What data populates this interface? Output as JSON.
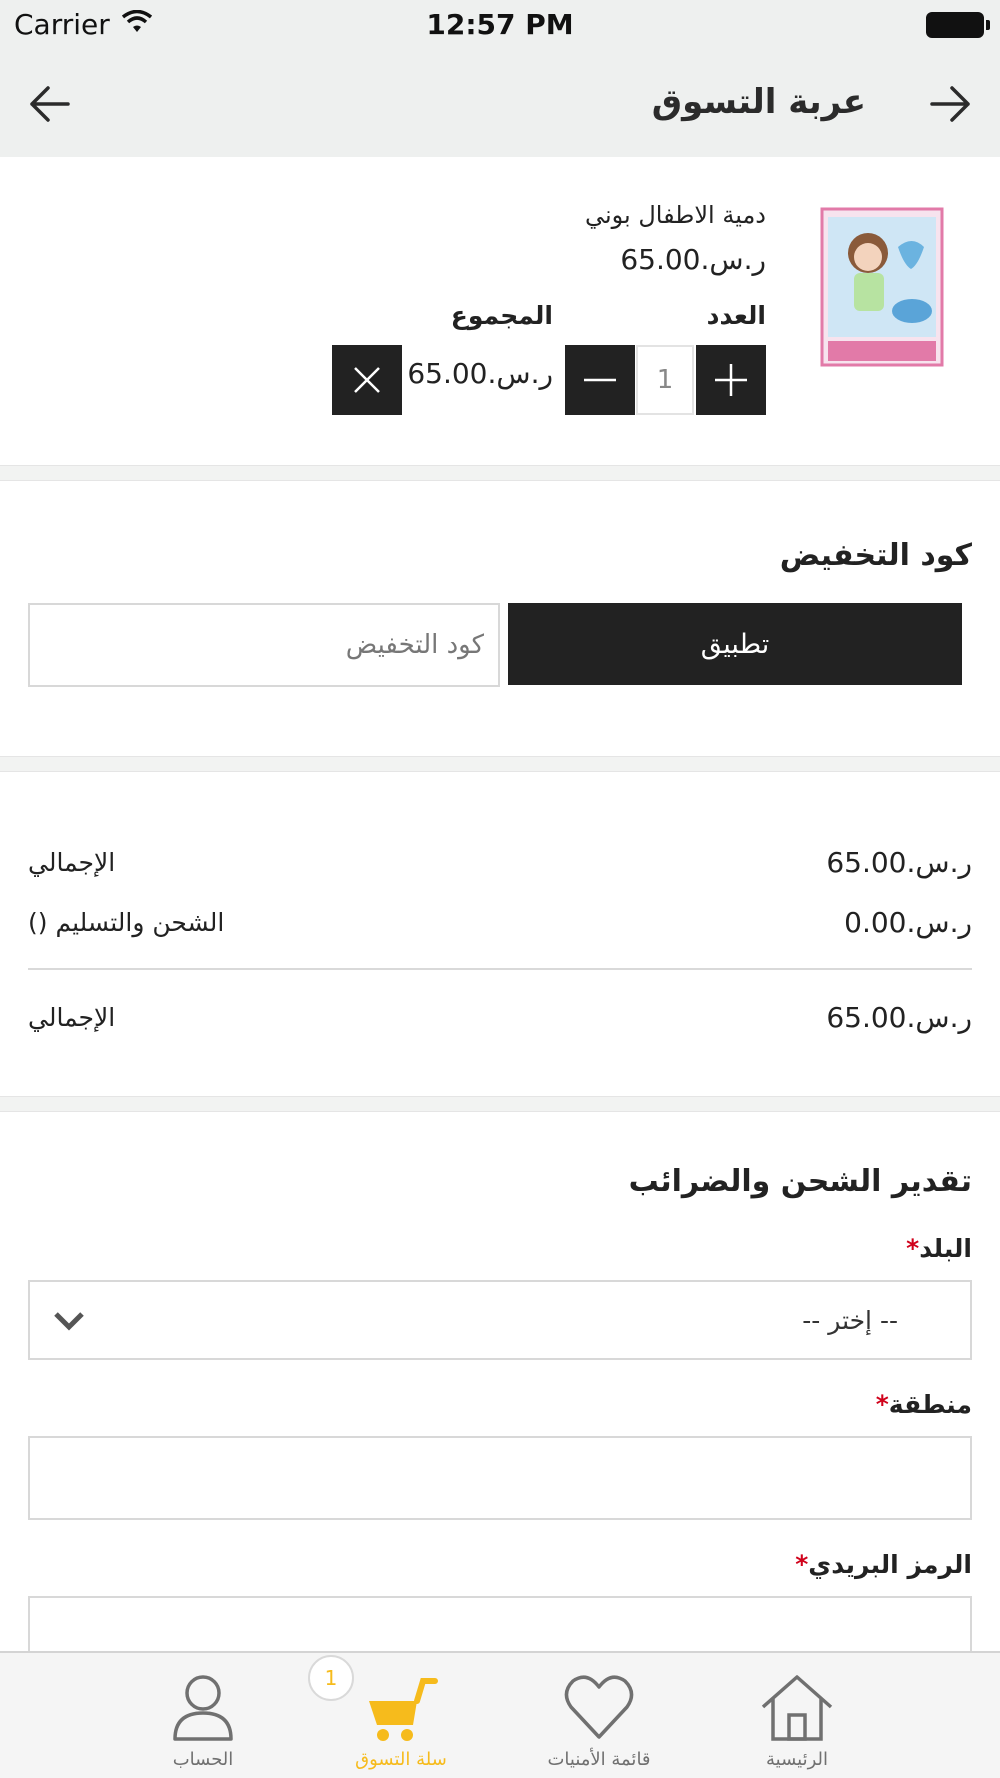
{
  "status_bar": {
    "carrier": "Carrier",
    "time": "12:57 PM"
  },
  "nav": {
    "title": "عربة التسوق",
    "back_icon": "arrow-left-icon",
    "forward_icon": "arrow-right-icon"
  },
  "cart_item": {
    "name": "دمية الاطفال بوني",
    "price": "ر.س.65.00",
    "quantity_label": "العدد",
    "total_label": "المجموع",
    "quantity": "1",
    "line_total": "ر.س.65.00"
  },
  "coupon": {
    "title": "كود التخفيض",
    "placeholder": "كود التخفيض",
    "apply_label": "تطبيق"
  },
  "totals": {
    "subtotal_label": "الإجمالي",
    "subtotal_value": "ر.س.65.00",
    "shipping_label": "الشحن والتسليم ()",
    "shipping_value": "ر.س.0.00",
    "grand_total_label": "الإجمالي",
    "grand_total_value": "ر.س.65.00"
  },
  "shipping_estimate": {
    "title": "تقدير الشحن والضرائب",
    "country_label": "البلد",
    "country_value": "-- إختر --",
    "region_label": "منطقة",
    "postcode_label": "الرمز البريدي",
    "required_mark": "*"
  },
  "tab_bar": {
    "tabs": [
      {
        "label": "الحساب",
        "icon": "person-icon"
      },
      {
        "label": "سلة التسوق",
        "icon": "cart-icon",
        "active": true
      },
      {
        "label": "قائمة الأمنيات",
        "icon": "heart-icon"
      },
      {
        "label": "الرئيسية",
        "icon": "home-icon"
      }
    ],
    "cart_badge": "1"
  },
  "colors": {
    "accent": "#f6bb1c",
    "dark": "#222222",
    "required": "#d0021b",
    "nav_bg": "#eef0ef"
  }
}
